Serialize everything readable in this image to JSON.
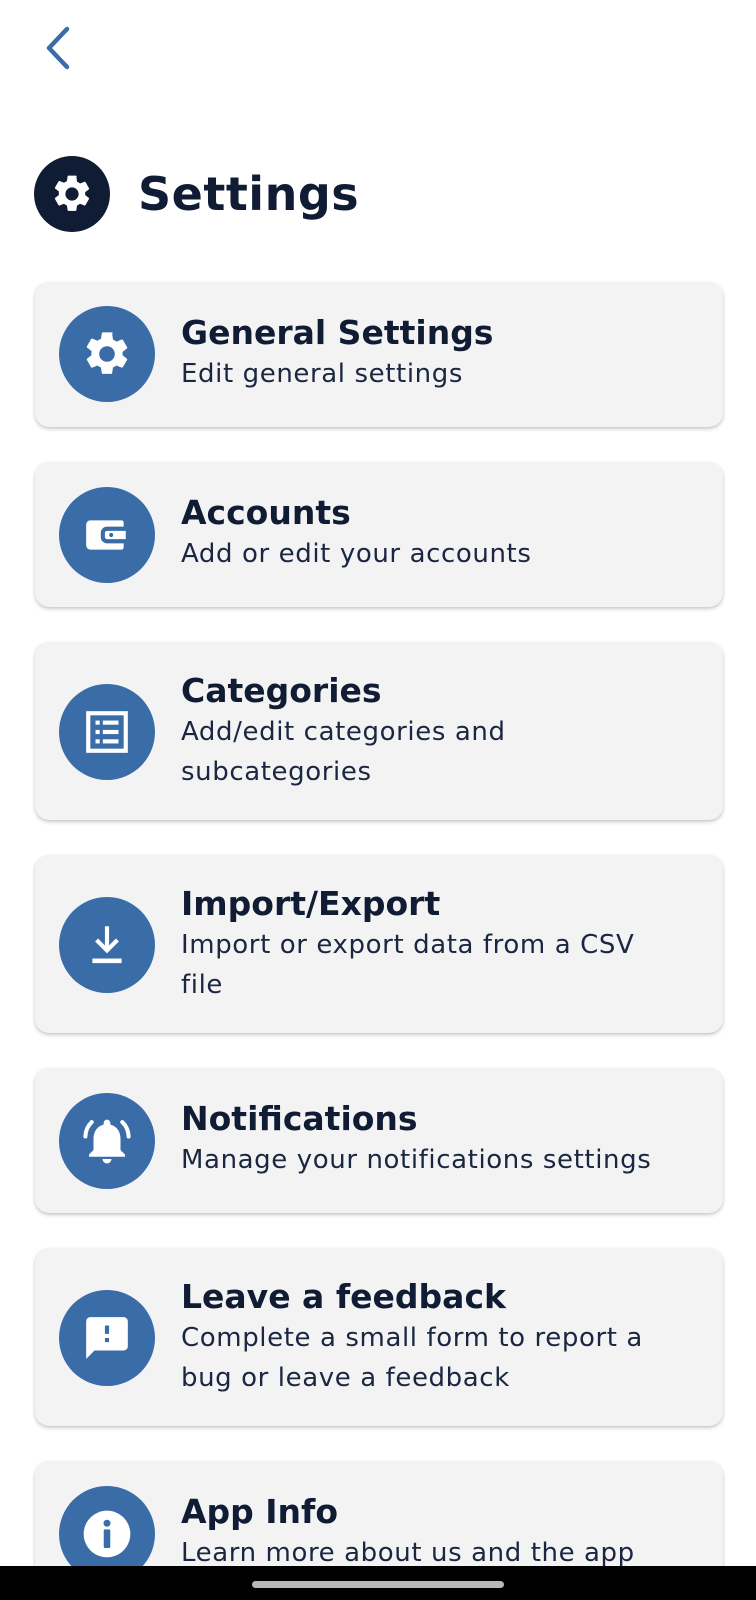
{
  "header": {
    "title": "Settings",
    "icon": "gear-icon",
    "back_icon": "chevron-left-icon"
  },
  "colors": {
    "primary_dark": "#0f1c33",
    "accent_blue": "#3a6ca8",
    "card_bg": "#f3f3f4"
  },
  "items": [
    {
      "title": "General Settings",
      "subtitle": "Edit general settings",
      "icon": "gear-icon"
    },
    {
      "title": "Accounts",
      "subtitle": "Add or edit your accounts",
      "icon": "wallet-icon"
    },
    {
      "title": "Categories",
      "subtitle": "Add/edit categories and subcategories",
      "icon": "list-icon"
    },
    {
      "title": "Import/Export",
      "subtitle": "Import or export data from a CSV file",
      "icon": "download-icon"
    },
    {
      "title": "Notifications",
      "subtitle": "Manage your notifications settings",
      "icon": "bell-ringing-icon"
    },
    {
      "title": "Leave a feedback",
      "subtitle": "Complete a small form to report a bug or leave a feedback",
      "icon": "feedback-icon"
    },
    {
      "title": "App Info",
      "subtitle": "Learn more about us and the app",
      "icon": "info-icon"
    }
  ]
}
